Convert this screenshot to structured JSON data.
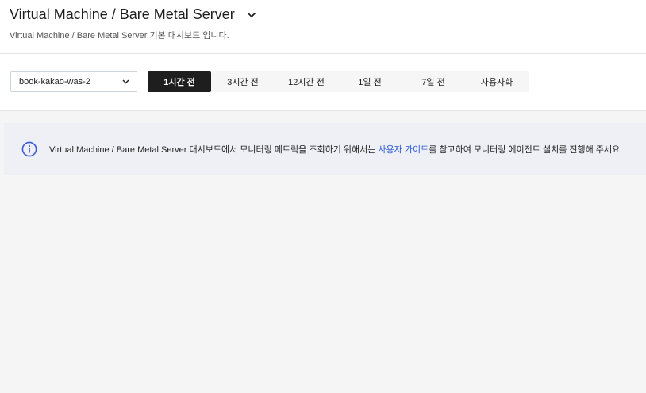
{
  "header": {
    "title": "Virtual Machine / Bare Metal Server",
    "subtitle": "Virtual Machine / Bare Metal Server 기본 대시보드 입니다.",
    "chevron_icon": "chevron-down-icon"
  },
  "toolbar": {
    "instance_select": {
      "value": "book-kakao-was-2",
      "icon": "chevron-down-icon"
    },
    "time_tabs": [
      {
        "label": "1시간 전",
        "active": true
      },
      {
        "label": "3시간 전",
        "active": false
      },
      {
        "label": "12시간 전",
        "active": false
      },
      {
        "label": "1일 전",
        "active": false
      },
      {
        "label": "7일 전",
        "active": false
      },
      {
        "label": "사용자화",
        "active": false
      }
    ]
  },
  "notice": {
    "icon": "info-icon",
    "text_before": "Virtual Machine / Bare Metal Server 대시보드에서 모니터링 메트릭을 조회하기 위해서는 ",
    "link_text": "사용자 가이드",
    "text_after": "를 참고하여 모니터링 에이전트 설치를 진행해 주세요."
  },
  "colors": {
    "active_tab_bg": "#1e1e1e",
    "link": "#2d5bd4",
    "info_icon": "#3b5bd6",
    "notice_bg": "#eff0f5",
    "page_bg": "#f5f5f5"
  }
}
